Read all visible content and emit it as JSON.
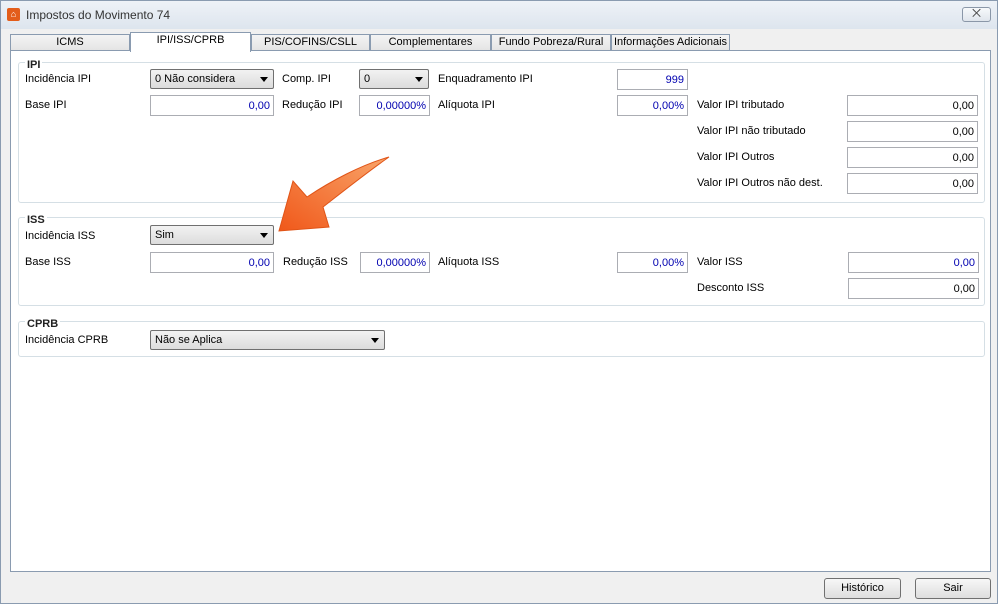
{
  "window": {
    "title": "Impostos do Movimento 74",
    "close_glyph": "⨉"
  },
  "tabs": [
    {
      "label": "ICMS"
    },
    {
      "label": "IPI/ISS/CPRB",
      "active": true
    },
    {
      "label": "PIS/COFINS/CSLL"
    },
    {
      "label": "Complementares"
    },
    {
      "label": "Fundo Pobreza/Rural"
    },
    {
      "label": "Informações Adicionais"
    }
  ],
  "ipi": {
    "title": "IPI",
    "incidencia_label": "Incidência IPI",
    "incidencia_value": "0 Não considera",
    "comp_label": "Comp. IPI",
    "comp_value": "0",
    "enquadramento_label": "Enquadramento IPI",
    "enquadramento_value": "999",
    "base_label": "Base IPI",
    "base_value": "0,00",
    "reducao_label": "Redução IPI",
    "reducao_value": "0,00000%",
    "aliquota_label": "Alíquota IPI",
    "aliquota_value": "0,00%",
    "valor_tributado_label": "Valor IPI tributado",
    "valor_tributado_value": "0,00",
    "valor_nao_tributado_label": "Valor IPI não tributado",
    "valor_nao_tributado_value": "0,00",
    "valor_outros_label": "Valor IPI Outros",
    "valor_outros_value": "0,00",
    "valor_outros_nao_dest_label": "Valor IPI Outros não dest.",
    "valor_outros_nao_dest_value": "0,00"
  },
  "iss": {
    "title": "ISS",
    "incidencia_label": "Incidência ISS",
    "incidencia_value": "Sim",
    "base_label": "Base ISS",
    "base_value": "0,00",
    "reducao_label": "Redução ISS",
    "reducao_value": "0,00000%",
    "aliquota_label": "Alíquota ISS",
    "aliquota_value": "0,00%",
    "valor_label": "Valor ISS",
    "valor_value": "0,00",
    "desconto_label": "Desconto ISS",
    "desconto_value": "0,00"
  },
  "cprb": {
    "title": "CPRB",
    "incidencia_label": "Incidência CPRB",
    "incidencia_value": "Não se Aplica"
  },
  "footer": {
    "historico_label": "Histórico",
    "sair_label": "Sair"
  },
  "colors": {
    "value_blue": "#0000b0",
    "annotation_arrow": "#f36a1f"
  }
}
